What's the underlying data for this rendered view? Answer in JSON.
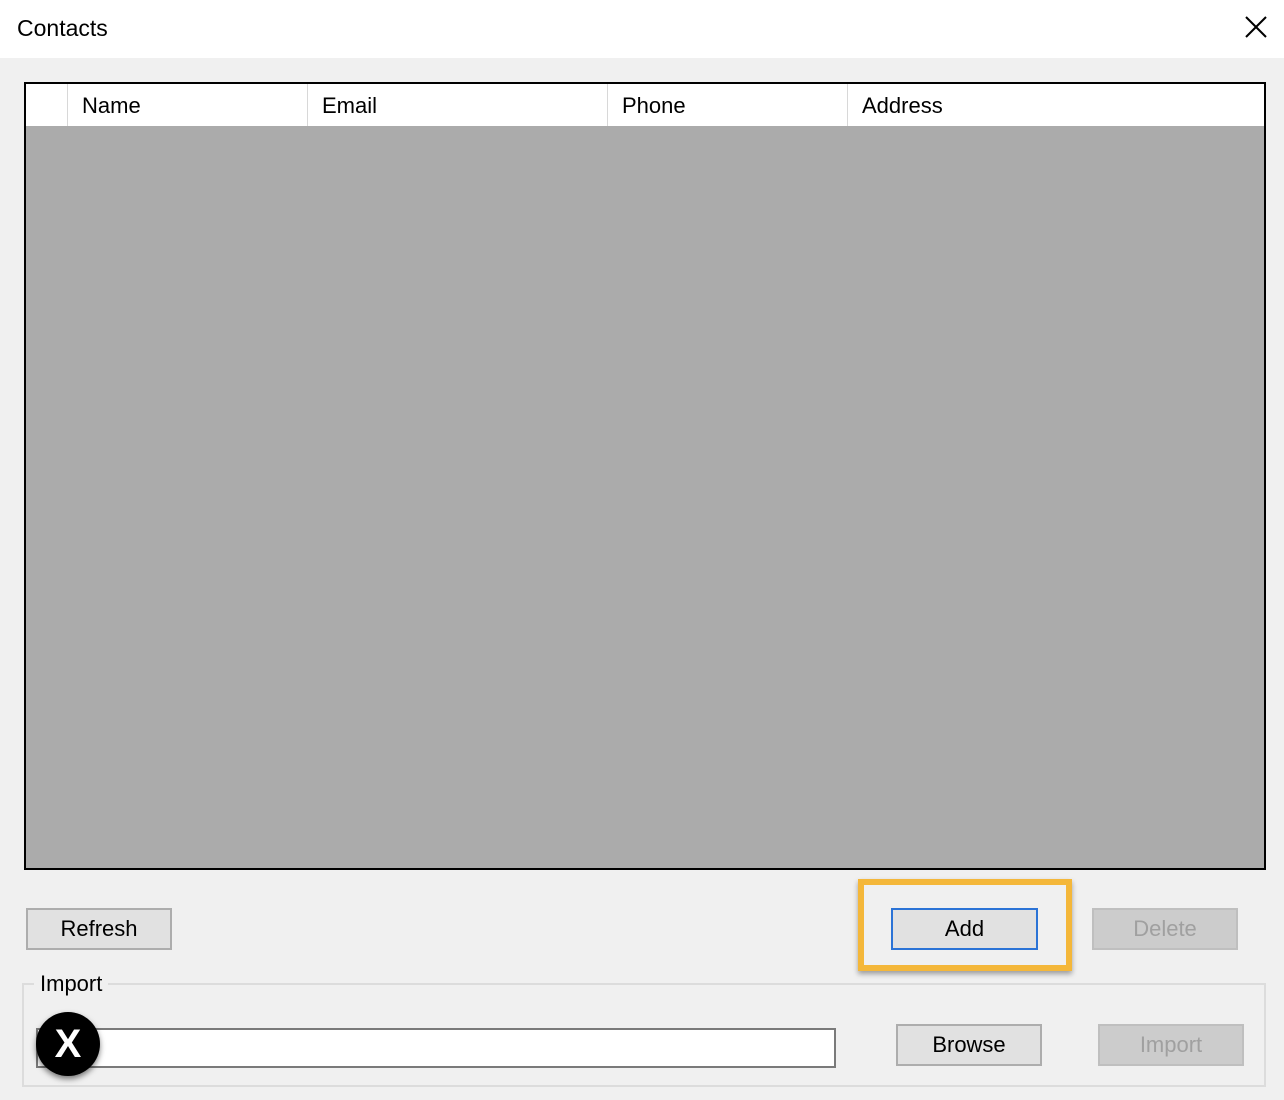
{
  "window": {
    "title": "Contacts",
    "close_icon": "close-icon"
  },
  "grid": {
    "columns": [
      "",
      "Name",
      "Email",
      "Phone",
      "Address"
    ],
    "rows": []
  },
  "buttons": {
    "refresh": "Refresh",
    "add": "Add",
    "delete": "Delete",
    "browse": "Browse",
    "import": "Import"
  },
  "import_group": {
    "label": "Import",
    "path_value": ""
  },
  "marker": {
    "label": "X"
  },
  "colors": {
    "highlight": "#f4b73a",
    "focus_border": "#2b73d6"
  }
}
